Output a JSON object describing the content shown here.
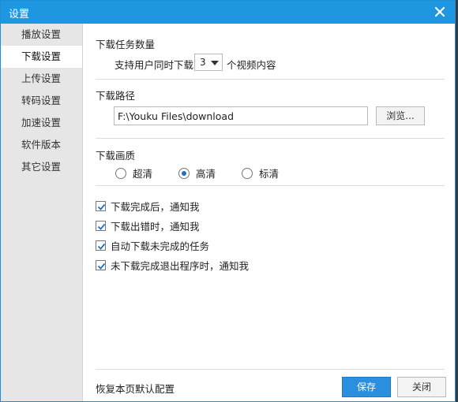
{
  "window": {
    "title": "设置"
  },
  "sidebar": {
    "items": [
      {
        "label": "播放设置"
      },
      {
        "label": "下载设置",
        "active": true
      },
      {
        "label": "上传设置"
      },
      {
        "label": "转码设置"
      },
      {
        "label": "加速设置"
      },
      {
        "label": "软件版本"
      },
      {
        "label": "其它设置"
      }
    ]
  },
  "download_count": {
    "title": "下载任务数量",
    "prefix": "支持用户同时下载",
    "value": "3",
    "suffix": "个视频内容"
  },
  "download_path": {
    "title": "下载路径",
    "value": "F:\\Youku Files\\download",
    "browse_label": "浏览..."
  },
  "download_quality": {
    "title": "下载画质",
    "options": [
      {
        "label": "超清",
        "selected": false
      },
      {
        "label": "高清",
        "selected": true
      },
      {
        "label": "标清",
        "selected": false
      }
    ]
  },
  "notifications": [
    {
      "label": "下载完成后，通知我",
      "checked": true
    },
    {
      "label": "下载出错时，通知我",
      "checked": true
    },
    {
      "label": "自动下载未完成的任务",
      "checked": true
    },
    {
      "label": "未下载完成退出程序时，通知我",
      "checked": true
    }
  ],
  "footer": {
    "reset_label": "恢复本页默认配置",
    "save_label": "保存",
    "close_label": "关闭"
  },
  "colors": {
    "accent": "#1e96e0",
    "sidebar_bg": "#e6e6e6"
  }
}
